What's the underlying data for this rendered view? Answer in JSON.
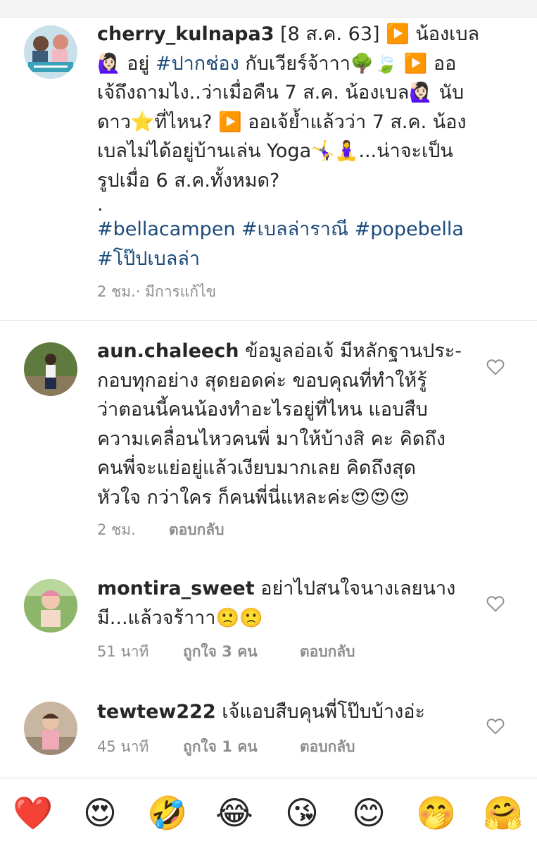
{
  "caption": {
    "username": "cherry_kulnapa3",
    "lines": [
      " [8 ส.ค. 63] ▶️ น้องเบล",
      "🙋🏻‍♀️ อยู่ ",
      " กับเวียร์จ้าาา🌳🍃 ▶️ ออ",
      "เจ้ถึงถามไง..ว่าเมื่อคืน 7 ส.ค. น้องเบล🙋🏻‍♀️ นับ",
      "ดาว⭐ที่ไหน? ▶️ ออเจ้ย้ำแล้วว่า 7 ส.ค. น้อง",
      "เบลไม่ได้อยู่บ้านเล่น Yoga🤸‍♀️🧘‍♀️...น่าจะเป็น",
      "รูปเมื่อ 6 ส.ค.ทั้งหมด?",
      "."
    ],
    "inline_tag": "#ปากช่อง",
    "hashtags_line1": "#bellacampen #เบลล่าราณี #popebella",
    "hashtags_line2": "#โป๊ปเบลล่า",
    "time": "2 ชม.",
    "edited": " · มีการแก้ไข"
  },
  "comments": [
    {
      "username": "aun.chaleech",
      "lines": [
        " ข้อมูลอ่อเจ้ มีหลักฐานประ-",
        "กอบทุกอย่าง สุดยอดค่ะ ขอบคุณที่ทำให้รู้",
        "ว่าตอนนี้คนน้องทำอะไรอยู่ที่ไหน แอบสืบ",
        "ความเคลื่อนไหวคนพี่ มาให้บ้างสิ คะ คิดถึง",
        "คนพี่จะแย่อยู่แล้วเงียบมากเลย คิดถึงสุด",
        "หัวใจ กว่าใคร ก็คนพี่นี่แหละค่ะ😍😍😍"
      ],
      "time": "2 ชม.",
      "likes": "",
      "reply": "ตอบกลับ"
    },
    {
      "username": "montira_sweet",
      "lines": [
        " อย่าไปสนใจนางเลยนาง",
        "มี...แล้วจร้าาา🙁🙁"
      ],
      "time": "51 นาที",
      "likes": "ถูกใจ 3 คน",
      "reply": "ตอบกลับ"
    },
    {
      "username": "tewtew222",
      "lines": [
        " เจ้แอบสืบคุนพี่โป๊บบ้างอ่ะ"
      ],
      "time": "45 นาที",
      "likes": "ถูกใจ 1 คน",
      "reply": "ตอบกลับ"
    }
  ],
  "reactions": [
    "❤️",
    "😍",
    "🤣",
    "😂",
    "😘",
    "😊",
    "🤭",
    "🤗"
  ],
  "colors": {
    "hashtag": "#1b4a7c",
    "meta": "#8e8e8e",
    "heart": "#ed4956"
  }
}
